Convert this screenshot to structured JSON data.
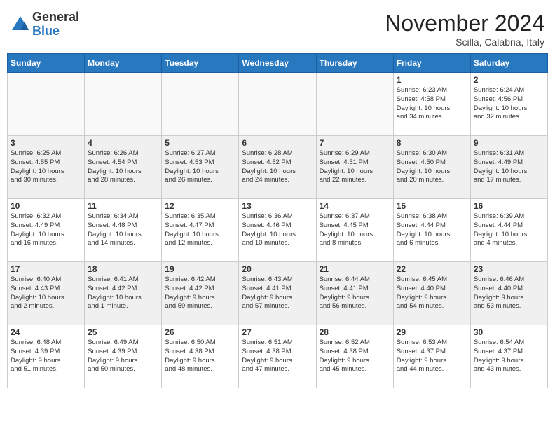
{
  "logo": {
    "general": "General",
    "blue": "Blue"
  },
  "title": "November 2024",
  "location": "Scilla, Calabria, Italy",
  "weekdays": [
    "Sunday",
    "Monday",
    "Tuesday",
    "Wednesday",
    "Thursday",
    "Friday",
    "Saturday"
  ],
  "weeks": [
    [
      {
        "day": "",
        "info": ""
      },
      {
        "day": "",
        "info": ""
      },
      {
        "day": "",
        "info": ""
      },
      {
        "day": "",
        "info": ""
      },
      {
        "day": "",
        "info": ""
      },
      {
        "day": "1",
        "info": "Sunrise: 6:23 AM\nSunset: 4:58 PM\nDaylight: 10 hours\nand 34 minutes."
      },
      {
        "day": "2",
        "info": "Sunrise: 6:24 AM\nSunset: 4:56 PM\nDaylight: 10 hours\nand 32 minutes."
      }
    ],
    [
      {
        "day": "3",
        "info": "Sunrise: 6:25 AM\nSunset: 4:55 PM\nDaylight: 10 hours\nand 30 minutes."
      },
      {
        "day": "4",
        "info": "Sunrise: 6:26 AM\nSunset: 4:54 PM\nDaylight: 10 hours\nand 28 minutes."
      },
      {
        "day": "5",
        "info": "Sunrise: 6:27 AM\nSunset: 4:53 PM\nDaylight: 10 hours\nand 26 minutes."
      },
      {
        "day": "6",
        "info": "Sunrise: 6:28 AM\nSunset: 4:52 PM\nDaylight: 10 hours\nand 24 minutes."
      },
      {
        "day": "7",
        "info": "Sunrise: 6:29 AM\nSunset: 4:51 PM\nDaylight: 10 hours\nand 22 minutes."
      },
      {
        "day": "8",
        "info": "Sunrise: 6:30 AM\nSunset: 4:50 PM\nDaylight: 10 hours\nand 20 minutes."
      },
      {
        "day": "9",
        "info": "Sunrise: 6:31 AM\nSunset: 4:49 PM\nDaylight: 10 hours\nand 17 minutes."
      }
    ],
    [
      {
        "day": "10",
        "info": "Sunrise: 6:32 AM\nSunset: 4:49 PM\nDaylight: 10 hours\nand 16 minutes."
      },
      {
        "day": "11",
        "info": "Sunrise: 6:34 AM\nSunset: 4:48 PM\nDaylight: 10 hours\nand 14 minutes."
      },
      {
        "day": "12",
        "info": "Sunrise: 6:35 AM\nSunset: 4:47 PM\nDaylight: 10 hours\nand 12 minutes."
      },
      {
        "day": "13",
        "info": "Sunrise: 6:36 AM\nSunset: 4:46 PM\nDaylight: 10 hours\nand 10 minutes."
      },
      {
        "day": "14",
        "info": "Sunrise: 6:37 AM\nSunset: 4:45 PM\nDaylight: 10 hours\nand 8 minutes."
      },
      {
        "day": "15",
        "info": "Sunrise: 6:38 AM\nSunset: 4:44 PM\nDaylight: 10 hours\nand 6 minutes."
      },
      {
        "day": "16",
        "info": "Sunrise: 6:39 AM\nSunset: 4:44 PM\nDaylight: 10 hours\nand 4 minutes."
      }
    ],
    [
      {
        "day": "17",
        "info": "Sunrise: 6:40 AM\nSunset: 4:43 PM\nDaylight: 10 hours\nand 2 minutes."
      },
      {
        "day": "18",
        "info": "Sunrise: 6:41 AM\nSunset: 4:42 PM\nDaylight: 10 hours\nand 1 minute."
      },
      {
        "day": "19",
        "info": "Sunrise: 6:42 AM\nSunset: 4:42 PM\nDaylight: 9 hours\nand 59 minutes."
      },
      {
        "day": "20",
        "info": "Sunrise: 6:43 AM\nSunset: 4:41 PM\nDaylight: 9 hours\nand 57 minutes."
      },
      {
        "day": "21",
        "info": "Sunrise: 6:44 AM\nSunset: 4:41 PM\nDaylight: 9 hours\nand 56 minutes."
      },
      {
        "day": "22",
        "info": "Sunrise: 6:45 AM\nSunset: 4:40 PM\nDaylight: 9 hours\nand 54 minutes."
      },
      {
        "day": "23",
        "info": "Sunrise: 6:46 AM\nSunset: 4:40 PM\nDaylight: 9 hours\nand 53 minutes."
      }
    ],
    [
      {
        "day": "24",
        "info": "Sunrise: 6:48 AM\nSunset: 4:39 PM\nDaylight: 9 hours\nand 51 minutes."
      },
      {
        "day": "25",
        "info": "Sunrise: 6:49 AM\nSunset: 4:39 PM\nDaylight: 9 hours\nand 50 minutes."
      },
      {
        "day": "26",
        "info": "Sunrise: 6:50 AM\nSunset: 4:38 PM\nDaylight: 9 hours\nand 48 minutes."
      },
      {
        "day": "27",
        "info": "Sunrise: 6:51 AM\nSunset: 4:38 PM\nDaylight: 9 hours\nand 47 minutes."
      },
      {
        "day": "28",
        "info": "Sunrise: 6:52 AM\nSunset: 4:38 PM\nDaylight: 9 hours\nand 45 minutes."
      },
      {
        "day": "29",
        "info": "Sunrise: 6:53 AM\nSunset: 4:37 PM\nDaylight: 9 hours\nand 44 minutes."
      },
      {
        "day": "30",
        "info": "Sunrise: 6:54 AM\nSunset: 4:37 PM\nDaylight: 9 hours\nand 43 minutes."
      }
    ]
  ]
}
